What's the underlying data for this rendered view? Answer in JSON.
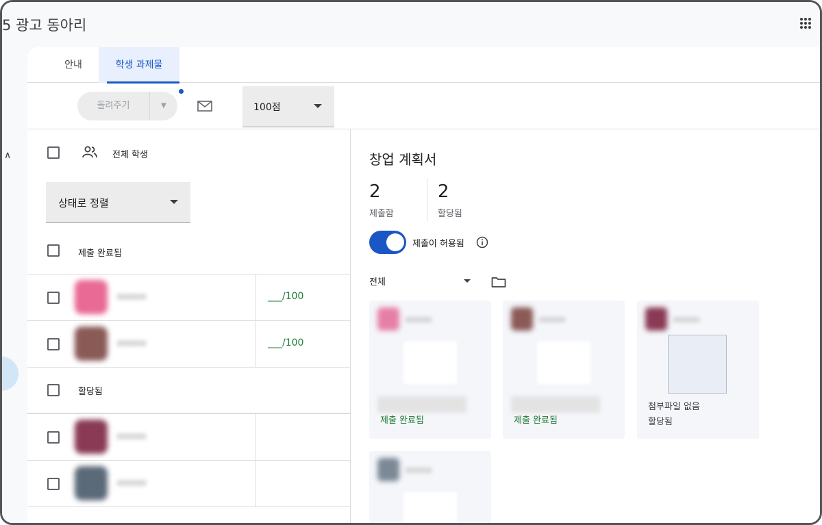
{
  "app": {
    "course_title": "5 광고 동아리"
  },
  "tabs": [
    {
      "label": "안내",
      "active": false
    },
    {
      "label": "학생 과제물",
      "active": true
    }
  ],
  "toolbar": {
    "return_label": "돌려주기",
    "points_value": "100점"
  },
  "roster": {
    "all_students_label": "전체 학생",
    "sort_label": "상태로 정렬",
    "sections": [
      {
        "label": "제출 완료됨",
        "rows": [
          {
            "grade": "___/100",
            "avatar_color": "#e86a95"
          },
          {
            "grade": "___/100",
            "avatar_color": "#8a5a57"
          }
        ]
      },
      {
        "label": "할당됨",
        "rows": [
          {
            "grade": "",
            "avatar_color": "#8a3a55"
          },
          {
            "grade": "",
            "avatar_color": "#5b6a78"
          }
        ]
      }
    ]
  },
  "assignment": {
    "title": "창업 계획서",
    "submitted_count": "2",
    "submitted_label": "제출함",
    "assigned_count": "2",
    "assigned_label": "할당됨",
    "accepting_label": "제출이 허용됨",
    "accepting": true,
    "filter_label": "전체"
  },
  "tiles": [
    {
      "status": "제출 완료됨",
      "avatar_color": "#e67fa6",
      "has_file": true
    },
    {
      "status": "제출 완료됨",
      "avatar_color": "#8a5a57",
      "has_file": true
    },
    {
      "status": "할당됨",
      "no_file_label": "첨부파일 없음",
      "avatar_color": "#8a3a55",
      "has_file": false
    },
    {
      "status": "",
      "avatar_color": "#7b8896",
      "has_file": true
    }
  ],
  "colors": {
    "accent": "#1a56c4",
    "success": "#1e7a34",
    "tab_active_bg": "#e8f0fe"
  }
}
